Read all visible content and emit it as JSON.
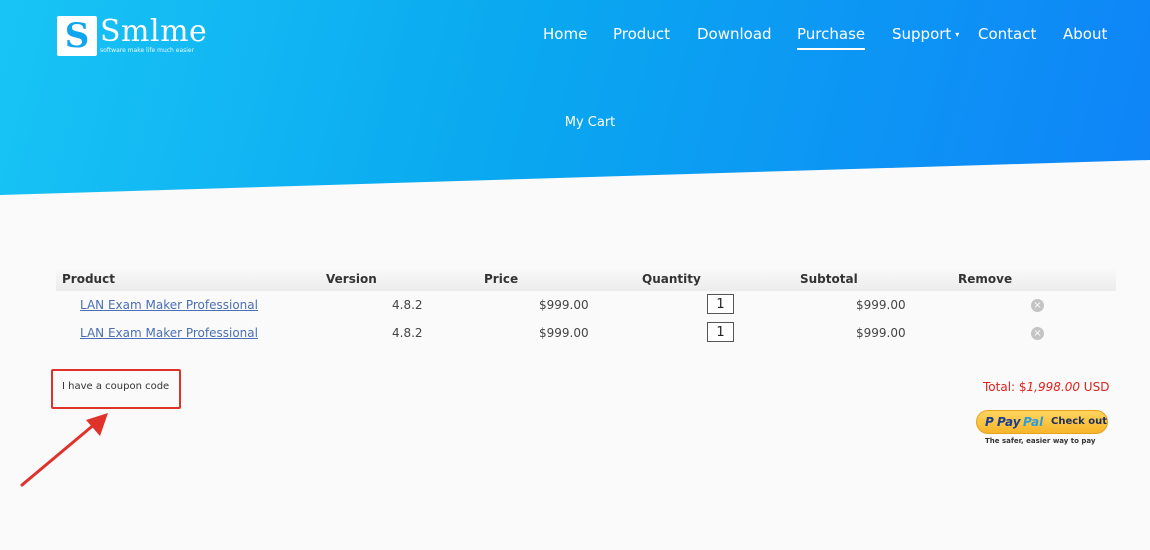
{
  "brand": {
    "logo_letter": "S",
    "name": "Smlme",
    "tagline": "software make life much easier"
  },
  "nav": {
    "home": "Home",
    "product": "Product",
    "download": "Download",
    "purchase": "Purchase",
    "support": "Support",
    "support_caret": "▾",
    "contact": "Contact",
    "about": "About",
    "active": "Purchase"
  },
  "page_title": "My Cart",
  "cart": {
    "headers": {
      "product": "Product",
      "version": "Version",
      "price": "Price",
      "quantity": "Quantity",
      "subtotal": "Subtotal",
      "remove": "Remove"
    },
    "items": [
      {
        "product": "LAN Exam Maker Professional",
        "version": "4.8.2",
        "price": "$999.00",
        "quantity": "1",
        "subtotal": "$999.00",
        "remove_icon": "×"
      },
      {
        "product": "LAN Exam Maker Professional",
        "version": "4.8.2",
        "price": "$999.00",
        "quantity": "1",
        "subtotal": "$999.00",
        "remove_icon": "×"
      }
    ]
  },
  "coupon": {
    "label": "I have a coupon code"
  },
  "total": {
    "label": "Total: $",
    "amount": "1,998.00",
    "currency": "USD"
  },
  "paypal": {
    "badge": "P",
    "word1": "Pay",
    "word2": "Pal",
    "button_label": "Check out",
    "tagline": "The safer, easier way to pay"
  },
  "colors": {
    "hero_start": "#18c4f5",
    "hero_end": "#0f84f8",
    "link": "#4a6fb5",
    "total": "#e4211c",
    "annotation": "#e0322a",
    "paypal_gold": "#ffc439"
  },
  "icons": [
    "logo-icon",
    "chevron-down-icon",
    "remove-icon",
    "paypal-icon",
    "annotation-arrow-icon"
  ]
}
